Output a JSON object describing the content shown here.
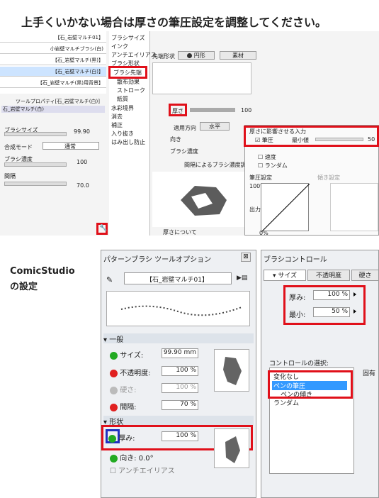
{
  "header": {
    "title": "上手くいかない場合は厚さの筆圧設定を調整してください。"
  },
  "csp": {
    "brush_list": [
      "【石_岩壁マルチ01】",
      "小岩壁マルチブラシ(白)",
      "【石_岩壁マルチ(黒)】",
      "【石_岩壁マルチ(白)】",
      "【石_岩壁マルチ(黒)用背景】"
    ],
    "tool_property_label": "ツールプロパティ[石_岩壁マルチ(白)]",
    "tool_name": "石_岩壁マルチ(白)",
    "brush_size_label": "ブラシサイズ",
    "brush_size_value": "99.90",
    "blend_mode_label": "合成モード",
    "blend_mode_value": "通常",
    "brush_density_label": "ブラシ濃度",
    "brush_density_value": "100",
    "interval_label": "間隔",
    "interval_value": "70.0",
    "categories": [
      "ブラシサイズ",
      "インク",
      "アンチエイリアス",
      "ブラシ形状",
      "ブラシ先端",
      "散布効果",
      "ストローク",
      "紙質",
      "水彩境界",
      "消去",
      "補正",
      "入り抜き",
      "はみ出し防止"
    ],
    "selected_category": "ブラシ先端",
    "tip_shape_label": "先端形状",
    "circle_label": "円形",
    "material_label": "素材",
    "thickness_label": "厚さ",
    "thickness_value": "100",
    "apply_direction_label": "適用方向",
    "horizontal_label": "水平",
    "direction_label": "向き",
    "brush_density_sub_label": "ブラシ濃度",
    "interval_brush_density_label": "間隔によるブラシ濃度調整",
    "about_thickness_label": "厚さについて",
    "popup_title": "厚さに影響させる入力",
    "pen_pressure_label": "筆圧",
    "min_value_label": "最小値",
    "min_value_number": "50",
    "speed_label": "速度",
    "random_label": "ランダム",
    "pressure_settings_label": "筆圧設定",
    "tilt_settings_label": "傾き設定",
    "output_label": "出力",
    "axis_100": "100%",
    "axis_0": "0%"
  },
  "cs": {
    "section_label": "ComicStudio\nの設定",
    "pattern_panel_title": "パターンブラシ ツールオプション",
    "brush_name": "【石_岩壁マルチ01】",
    "general_label": "一般",
    "size_label": "サイズ:",
    "size_value": "99.90 mm",
    "opacity_label": "不透明度:",
    "opacity_value": "100 %",
    "hardness_label": "硬さ:",
    "hardness_value": "100 %",
    "interval_label": "間隔:",
    "interval_value": "70 %",
    "shape_label": "形状",
    "thickness_label": "厚み:",
    "thickness_value": "100 %",
    "direction_label": "向き:",
    "direction_value": "0.0°",
    "antialias_label": "アンチエイリアス",
    "brush_control_title": "ブラシコントロール",
    "tabs": [
      "サイズ",
      "不透明度",
      "硬さ"
    ],
    "bc_thickness_label": "厚み:",
    "bc_thickness_value": "100 %",
    "bc_min_label": "最小:",
    "bc_min_value": "50 %",
    "control_select_label": "コントロールの選択:",
    "fixed_label": "固有",
    "control_options": [
      "変化なし",
      "ペンの筆圧",
      "ペンの傾き",
      "ランダム"
    ],
    "selected_control": "ペンの筆圧"
  },
  "colors": {
    "accent_red": "#e0101a",
    "accent_blue": "#2030c0",
    "selection_blue": "#3399ff",
    "green": "#22aa22"
  }
}
